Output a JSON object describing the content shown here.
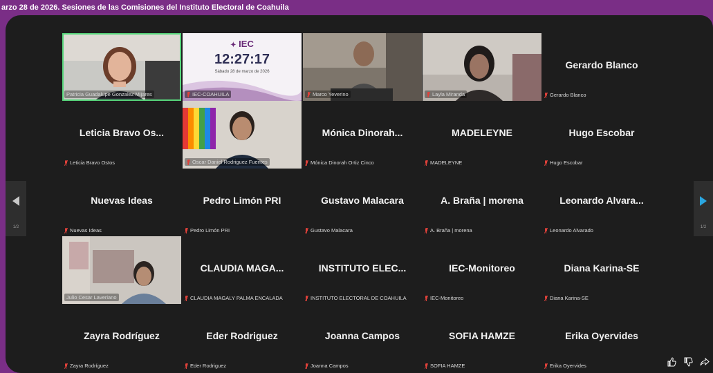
{
  "title": "arzo 28 de 2026. Sesiones de las Comisiones del Instituto Electoral de Coahuila",
  "clock": {
    "logo_text": "IEC",
    "time": "12:27:17",
    "date": "Sábado 28 de marzo de 2026",
    "label": "IEC-COAHUILA"
  },
  "tiles": [
    {
      "display": "",
      "label": "Patricia Guadalupe Gonzalez Mijares",
      "video": true
    },
    {
      "display": "",
      "label": "IEC-COAHUILA",
      "video": true
    },
    {
      "display": "",
      "label": "Marco Yeverino",
      "video": true
    },
    {
      "display": "",
      "label": "Layla Miranda",
      "video": true
    },
    {
      "display": "Gerardo Blanco",
      "label": "Gerardo Blanco",
      "video": false
    },
    {
      "display": "Leticia Bravo Os...",
      "label": "Leticia Bravo Ostos",
      "video": false
    },
    {
      "display": "",
      "label": "Oscar Daniel Rodriguez Fuentes",
      "video": true
    },
    {
      "display": "Mónica Dinorah...",
      "label": "Mónica Dinorah Ortiz Cinco",
      "video": false
    },
    {
      "display": "MADELEYNE",
      "label": "MADELEYNE",
      "video": false
    },
    {
      "display": "Hugo Escobar",
      "label": "Hugo Escobar",
      "video": false
    },
    {
      "display": "Nuevas Ideas",
      "label": "Nuevas Ideas",
      "video": false
    },
    {
      "display": "Pedro Limón PRI",
      "label": "Pedro Limón PRI",
      "video": false
    },
    {
      "display": "Gustavo Malacara",
      "label": "Gustavo Malacara",
      "video": false
    },
    {
      "display": "A. Braña | morena",
      "label": "A. Braña | morena",
      "video": false
    },
    {
      "display": "Leonardo Alvara...",
      "label": "Leonardo Alvarado",
      "video": false
    },
    {
      "display": "",
      "label": "Julio Cesar Laveriano",
      "video": true
    },
    {
      "display": "CLAUDIA MAGA...",
      "label": "CLAUDIA MAGALY PALMA ENCALADA",
      "video": false
    },
    {
      "display": "INSTITUTO ELEC...",
      "label": "INSTITUTO ELECTORAL DE COAHUILA",
      "video": false
    },
    {
      "display": "IEC-Monitoreo",
      "label": "IEC-Monitoreo",
      "video": false
    },
    {
      "display": "Diana Karina-SE",
      "label": "Diana Karina-SE",
      "video": false
    },
    {
      "display": "Zayra Rodríguez",
      "label": "Zayra Rodríguez",
      "video": false
    },
    {
      "display": "Eder Rodriguez",
      "label": "Eder Rodriguez",
      "video": false
    },
    {
      "display": "Joanna Campos",
      "label": "Joanna Campos",
      "video": false
    },
    {
      "display": "SOFIA HAMZE",
      "label": "SOFIA HAMZE",
      "video": false
    },
    {
      "display": "Erika Oyervides",
      "label": "Erika Oyervides",
      "video": false
    }
  ],
  "nav": {
    "prev_page": "1/2",
    "next_page": "1/2"
  },
  "colors": {
    "accent": "#7a2e86",
    "stage_bg": "#1d1d1d",
    "speaker_outline": "#57d67b",
    "mic_muted": "#e0413a",
    "next_arrow": "#2aa6e0"
  }
}
